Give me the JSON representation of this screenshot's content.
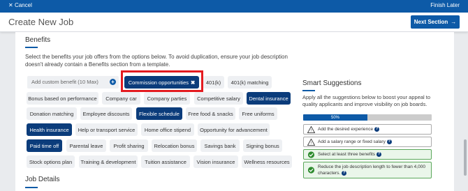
{
  "topbar": {
    "cancel_label": "Cancel",
    "finish_label": "Finish Later"
  },
  "header": {
    "title": "Create New Job",
    "next_label": "Next Section"
  },
  "benefits": {
    "title": "Benefits",
    "description": "Select the benefits your job offers from the options below. To avoid duplication, ensure your job description doesn't already contain a Benefits section from a template.",
    "custom_placeholder": "Add custom benefit (10 Max)",
    "chips": [
      {
        "label": "Commission opportunities",
        "selected": true,
        "removable": true
      },
      {
        "label": "401(k)",
        "selected": false
      },
      {
        "label": "401(k) matching",
        "selected": false
      },
      {
        "label": "Bonus based on performance",
        "selected": false
      },
      {
        "label": "Company car",
        "selected": false
      },
      {
        "label": "Company parties",
        "selected": false
      },
      {
        "label": "Competitive salary",
        "selected": false
      },
      {
        "label": "Dental insurance",
        "selected": true
      },
      {
        "label": "Donation matching",
        "selected": false
      },
      {
        "label": "Employee discounts",
        "selected": false
      },
      {
        "label": "Flexible schedule",
        "selected": true
      },
      {
        "label": "Free food & snacks",
        "selected": false
      },
      {
        "label": "Free uniforms",
        "selected": false
      },
      {
        "label": "Health insurance",
        "selected": true
      },
      {
        "label": "Help or transport service",
        "selected": false
      },
      {
        "label": "Home office stipend",
        "selected": false
      },
      {
        "label": "Opportunity for advancement",
        "selected": false
      },
      {
        "label": "Paid time off",
        "selected": true
      },
      {
        "label": "Parental leave",
        "selected": false
      },
      {
        "label": "Profit sharing",
        "selected": false
      },
      {
        "label": "Relocation bonus",
        "selected": false
      },
      {
        "label": "Savings bank",
        "selected": false
      },
      {
        "label": "Signing bonus",
        "selected": false
      },
      {
        "label": "Stock options plan",
        "selected": false
      },
      {
        "label": "Training & development",
        "selected": false
      },
      {
        "label": "Tuition assistance",
        "selected": false
      },
      {
        "label": "Vision insurance",
        "selected": false
      },
      {
        "label": "Wellness resources",
        "selected": false
      }
    ]
  },
  "smart": {
    "title": "Smart Suggestions",
    "description": "Apply all the suggestions below to boost your appeal to quality applicants and improve visibility on job boards.",
    "progress_label": "50%",
    "progress_fraction": 0.5,
    "suggestions": [
      {
        "text": "Add the desired experience",
        "status": "warning"
      },
      {
        "text": "Add a salary range or fixed salary",
        "status": "warning"
      },
      {
        "text": "Select at least three benefits",
        "status": "done"
      },
      {
        "text": "Reduce the job description length to fewer than 4,000 characters.",
        "status": "done"
      }
    ]
  },
  "job_details": {
    "title": "Job Details"
  },
  "colors": {
    "brand": "#0d5aa7",
    "selected_chip": "#0b3c7b",
    "highlight": "#e41b20",
    "success": "#5aa75a"
  }
}
